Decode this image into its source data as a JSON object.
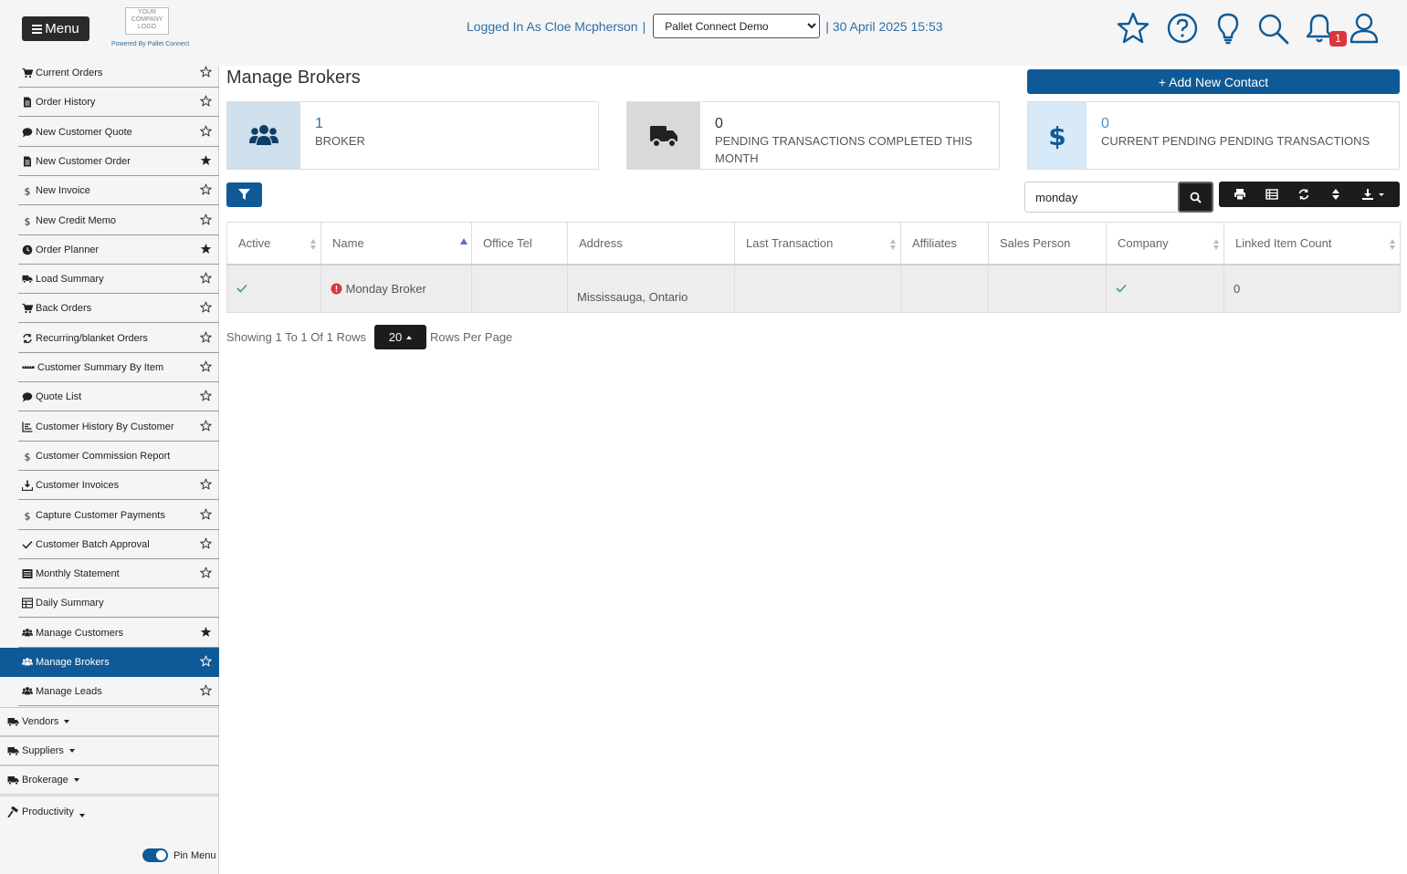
{
  "header": {
    "menu_label": "Menu",
    "logo_text": "YOUR COMPANY LOGO",
    "powered_by": "Powered By Pallet Connect",
    "logged_in": "Logged In As Cloe Mcpherson",
    "separator": "|",
    "org_selected": "Pallet Connect Demo",
    "datetime": "30 April 2025 15:53",
    "notification_count": "1"
  },
  "sidebar": {
    "items": [
      {
        "label": "Current Orders",
        "icon": "cart-icon",
        "starred": false
      },
      {
        "label": "Order History",
        "icon": "file-icon",
        "starred": false
      },
      {
        "label": "New Customer Quote",
        "icon": "comment-icon",
        "starred": false
      },
      {
        "label": "New Customer Order",
        "icon": "file-icon",
        "starred": true
      },
      {
        "label": "New Invoice",
        "icon": "dollar-icon",
        "starred": false
      },
      {
        "label": "New Credit Memo",
        "icon": "dollar-icon",
        "starred": false
      },
      {
        "label": "Order Planner",
        "icon": "clock-icon",
        "starred": true
      },
      {
        "label": "Load Summary",
        "icon": "truck-icon",
        "starred": false
      },
      {
        "label": "Back Orders",
        "icon": "cart-icon",
        "starred": false
      },
      {
        "label": "Recurring/blanket Orders",
        "icon": "refresh-icon",
        "starred": false
      },
      {
        "label": "Customer Summary By Item",
        "icon": "ruler-icon",
        "starred": false
      },
      {
        "label": "Quote List",
        "icon": "comment-icon",
        "starred": false
      },
      {
        "label": "Customer History By Customer",
        "icon": "chart-icon",
        "starred": false
      },
      {
        "label": "Customer Commission Report",
        "icon": "dollar-icon",
        "starred": null
      },
      {
        "label": "Customer Invoices",
        "icon": "download-icon",
        "starred": false
      },
      {
        "label": "Capture Customer Payments",
        "icon": "dollar-icon",
        "starred": false
      },
      {
        "label": "Customer Batch Approval",
        "icon": "check-icon",
        "starred": false
      },
      {
        "label": "Monthly Statement",
        "icon": "list-icon",
        "starred": false
      },
      {
        "label": "Daily Summary",
        "icon": "table-icon",
        "starred": null
      },
      {
        "label": "Manage Customers",
        "icon": "users-icon",
        "starred": true
      },
      {
        "label": "Manage Brokers",
        "icon": "users-icon",
        "starred": false,
        "active": true
      },
      {
        "label": "Manage Leads",
        "icon": "users-icon",
        "starred": false
      }
    ],
    "groups": [
      {
        "label": "Vendors",
        "icon": "truck-icon"
      },
      {
        "label": "Suppliers",
        "icon": "truck-icon"
      },
      {
        "label": "Brokerage",
        "icon": "truck-icon"
      },
      {
        "label": "Productivity",
        "icon": "hammer-icon"
      }
    ],
    "pin_label": "Pin Menu"
  },
  "main": {
    "title": "Manage Brokers",
    "add_button": "+ Add New Contact",
    "cards": [
      {
        "value": "1",
        "label": "BROKER",
        "icon": "users-icon",
        "bg": "#cfdfec",
        "value_color": "#2f6ea5"
      },
      {
        "value": "0",
        "label": "PENDING TRANSACTIONS COMPLETED THIS MONTH",
        "icon": "truck-icon",
        "bg": "#d9d9d9",
        "value_color": "#333333"
      },
      {
        "value": "0",
        "label": "CURRENT PENDING PENDING TRANSACTIONS",
        "icon": "dollar-icon",
        "bg": "#d8e9f8",
        "value_color": "#4f8fd0"
      }
    ],
    "search_value": "monday",
    "table": {
      "columns": [
        "Active",
        "Name",
        "Office Tel",
        "Address",
        "Last Transaction",
        "Affiliates",
        "Sales Person",
        "Company",
        "Linked Item Count"
      ],
      "rows": [
        {
          "active": "check",
          "name": "Monday Broker",
          "office_tel": "",
          "address": "Mississauga, Ontario",
          "last_transaction": "",
          "affiliates": "",
          "sales_person": "",
          "company": "check",
          "linked_item_count": "0"
        }
      ]
    },
    "pager": {
      "showing": "Showing 1 To 1 Of 1 Rows",
      "per_page": "20",
      "per_page_label": "Rows Per Page"
    }
  },
  "colors": {
    "primary": "#0f5a96",
    "link": "#2f6ea5",
    "dark": "#1c1c1c",
    "danger": "#d9363e",
    "success": "#3aa655"
  }
}
